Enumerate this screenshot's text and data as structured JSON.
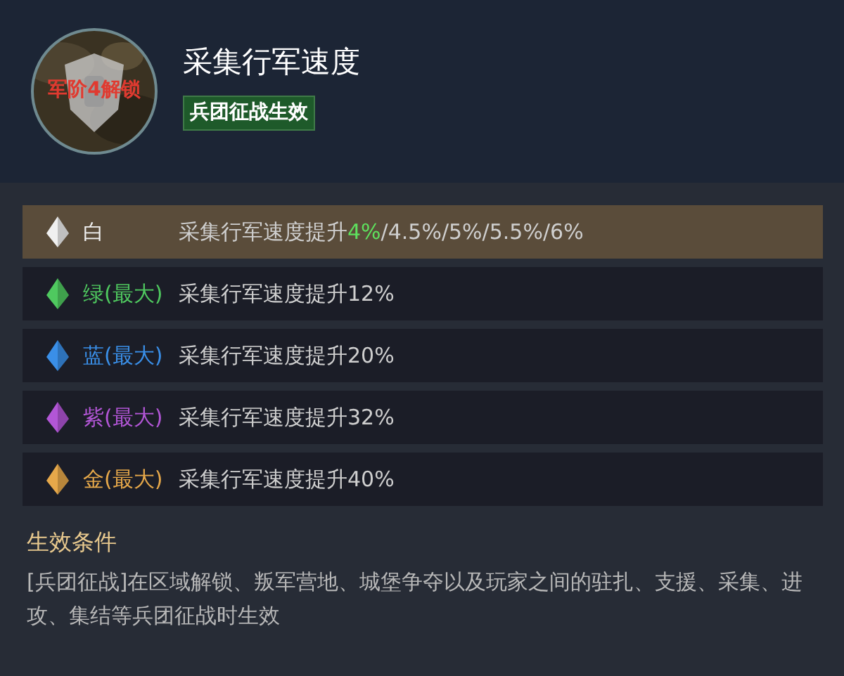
{
  "skill": {
    "title": "采集行军速度",
    "lock_text": "军阶4解锁",
    "tag": "兵团征战生效"
  },
  "tiers": [
    {
      "label": "白",
      "color": "#f0f0f0",
      "selected": true,
      "effect": "采集行军速度提升",
      "highlight": "4%",
      "rest": "/4.5%/5%/5.5%/6%"
    },
    {
      "label": "绿(最大)",
      "color": "#4fc95f",
      "selected": false,
      "effect": "采集行军速度提升12%"
    },
    {
      "label": "蓝(最大)",
      "color": "#3a8fe8",
      "selected": false,
      "effect": "采集行军速度提升20%"
    },
    {
      "label": "紫(最大)",
      "color": "#b256d6",
      "selected": false,
      "effect": "采集行军速度提升32%"
    },
    {
      "label": "金(最大)",
      "color": "#e6a84a",
      "selected": false,
      "effect": "采集行军速度提升40%"
    }
  ],
  "condition": {
    "heading": "生效条件",
    "text": "[兵团征战]在区域解锁、叛军营地、城堡争夺以及玩家之间的驻扎、支援、采集、进攻、集结等兵团征战时生效"
  }
}
